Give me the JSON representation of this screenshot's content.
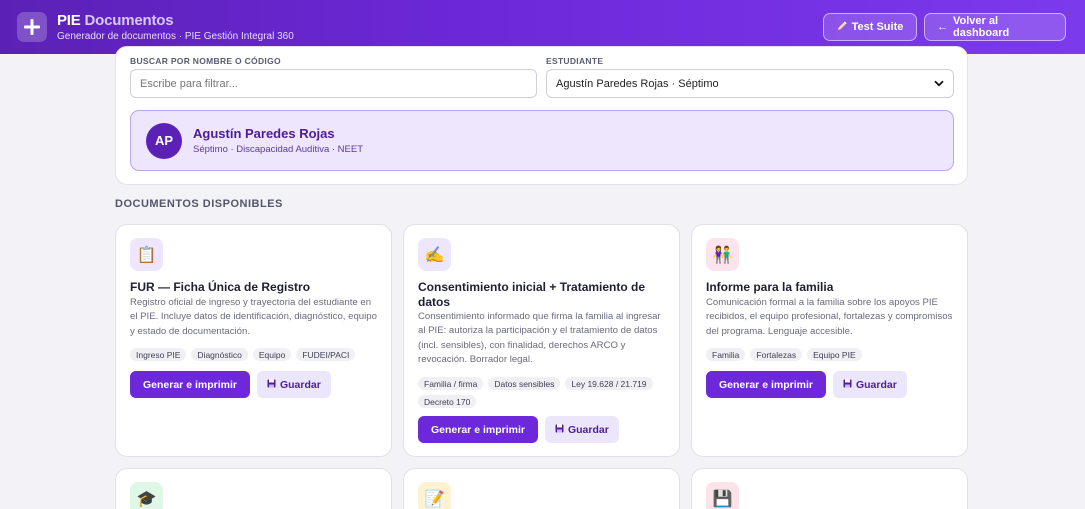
{
  "header": {
    "title_main": "PIE",
    "title_accent": "Documentos",
    "subtitle": "Generador de documentos · PIE Gestión Integral 360",
    "test_suite_label": "Test Suite",
    "back_label": "Volver al dashboard",
    "back_arrow": "←"
  },
  "filters": {
    "search_label": "BUSCAR POR NOMBRE O CÓDIGO",
    "search_placeholder": "Escribe para filtrar...",
    "student_label": "ESTUDIANTE",
    "student_selected": "Agustín Paredes Rojas · Séptimo"
  },
  "student": {
    "initials": "AP",
    "name": "Agustín Paredes Rojas",
    "meta": "Séptimo · Discapacidad Auditiva · NEET"
  },
  "section_title": "DOCUMENTOS DISPONIBLES",
  "documents": [
    {
      "icon": "clipboard-icon",
      "icon_glyph": "📋",
      "icon_bg": "#ede6fd",
      "title": "FUR — Ficha Única de Registro",
      "description": "Registro oficial de ingreso y trayectoria del estudiante en el PIE. Incluye datos de identificación, diagnóstico, equipo y estado de documentación.",
      "tags": [
        "Ingreso PIE",
        "Diagnóstico",
        "Equipo",
        "FUDEI/PACI"
      ],
      "primary_label": "Generar e imprimir",
      "secondary_label": "Guardar"
    },
    {
      "icon": "writing-hand-icon",
      "icon_glyph": "✍️",
      "icon_bg": "#ede6fd",
      "title": "Consentimiento inicial + Tratamiento de datos",
      "description": "Consentimiento informado que firma la familia al ingresar al PIE: autoriza la participación y el tratamiento de datos (incl. sensibles), con finalidad, derechos ARCO y revocación. Borrador legal.",
      "tags": [
        "Familia / firma",
        "Datos sensibles",
        "Ley 19.628 / 21.719",
        "Decreto 170"
      ],
      "primary_label": "Generar e imprimir",
      "secondary_label": "Guardar"
    },
    {
      "icon": "family-icon",
      "icon_glyph": "👫",
      "icon_bg": "#fce4ef",
      "title": "Informe para la familia",
      "description": "Comunicación formal a la familia sobre los apoyos PIE recibidos, el equipo profesional, fortalezas y compromisos del programa. Lenguaje accesible.",
      "tags": [
        "Familia",
        "Fortalezas",
        "Equipo PIE"
      ],
      "primary_label": "Generar e imprimir",
      "secondary_label": "Guardar"
    },
    {
      "icon": "graduation-cap-icon",
      "icon_glyph": "🎓",
      "icon_bg": "#dff7e6"
    },
    {
      "icon": "memo-icon",
      "icon_glyph": "📝",
      "icon_bg": "#fdf3d3"
    },
    {
      "icon": "floppy-disk-icon",
      "icon_glyph": "💾",
      "icon_bg": "#fbe3ea"
    }
  ],
  "colors": {
    "brand": "#6d28d9",
    "brand_dark": "#5b21b6",
    "student_bg": "#ede6fd"
  }
}
